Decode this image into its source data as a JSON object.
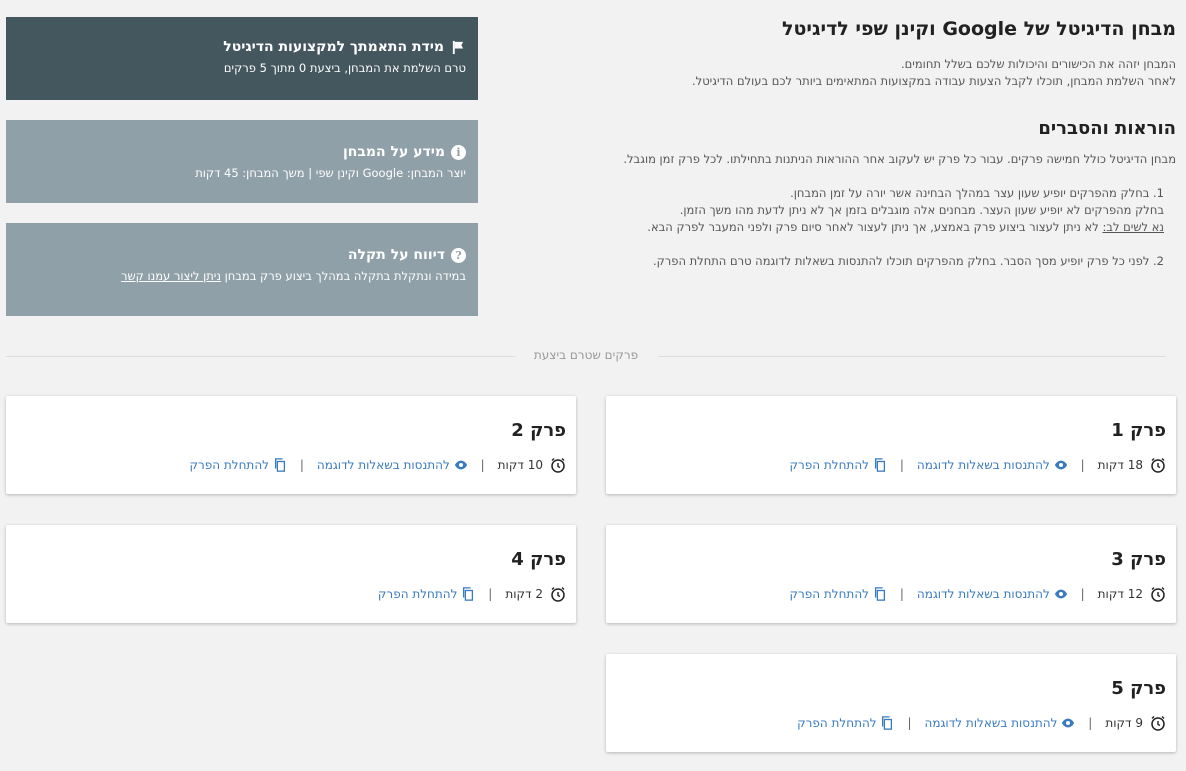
{
  "intro": {
    "title": "מבחן הדיגיטל של Google וקינן שפי לדיגיטל",
    "line1": "המבחן יזהה את הכישורים והיכולות שלכם בשלל תחומים.",
    "line2": "לאחר השלמת המבחן, תוכלו לקבל הצעות עבודה במקצועות המתאימים ביותר לכם בעולם הדיגיטל."
  },
  "instructions": {
    "title": "הוראות והסברים",
    "intro": "מבחן הדיגיטל כולל חמישה פרקים. עבור כל פרק יש לעקוב אחר ההוראות הניתנות בתחילתו. לכל פרק זמן מוגבל.",
    "item1_a": "1. בחלק מהפרקים יופיע שעון עצר במהלך הבחינה אשר יורה על זמן המבחן.",
    "item1_b": "בחלק מהפרקים לא יופיע שעון העצר. מבחנים אלה מוגבלים בזמן אך לא ניתן לדעת מהו משך הזמן.",
    "note_label": "נא לשים לב:",
    "note_text": " לא ניתן לעצור ביצוע פרק באמצע, אך ניתן לעצור לאחר סיום פרק ולפני המעבר לפרק הבא.",
    "item2": "2. לפני כל פרק יופיע מסך הסבר. בחלק מהפרקים תוכלו להתנסות בשאלות לדוגמה טרם התחלת הפרק."
  },
  "panels": {
    "match": {
      "title": "מידת התאמתך למקצועות הדיגיטל",
      "text": "טרם השלמת את המבחן, ביצעת 0 מתוך 5 פרקים",
      "icon": "flag-icon"
    },
    "info": {
      "title": "מידע על המבחן",
      "text": "יוצר המבחן: Google וקינן שפי | משך המבחן: 45 דקות",
      "icon": "info-icon"
    },
    "report": {
      "title": "דיווח על תקלה",
      "text": "במידה ונתקלת בתקלה במהלך ביצוע פרק במבחן ",
      "link": "ניתן ליצור עמנו קשר",
      "icon": "help-icon"
    }
  },
  "divider_label": "פרקים שטרם ביצעת",
  "chapters": [
    {
      "title": "פרק 1",
      "duration": "18 דקות",
      "practice": "להתנסות בשאלות לדוגמה",
      "start": "להתחלת הפרק"
    },
    {
      "title": "פרק 2",
      "duration": "10 דקות",
      "practice": "להתנסות בשאלות לדוגמה",
      "start": "להתחלת הפרק"
    },
    {
      "title": "פרק 3",
      "duration": "12 דקות",
      "practice": "להתנסות בשאלות לדוגמה",
      "start": "להתחלת הפרק"
    },
    {
      "title": "פרק 4",
      "duration": "2 דקות",
      "start": "להתחלת הפרק"
    },
    {
      "title": "פרק 5",
      "duration": "9 דקות",
      "practice": "להתנסות בשאלות לדוגמה",
      "start": "להתחלת הפרק"
    }
  ],
  "separator": "|",
  "colors": {
    "dark_panel": "#44575f",
    "light_panel": "#8fa0a8",
    "link": "#3a7bbf"
  }
}
